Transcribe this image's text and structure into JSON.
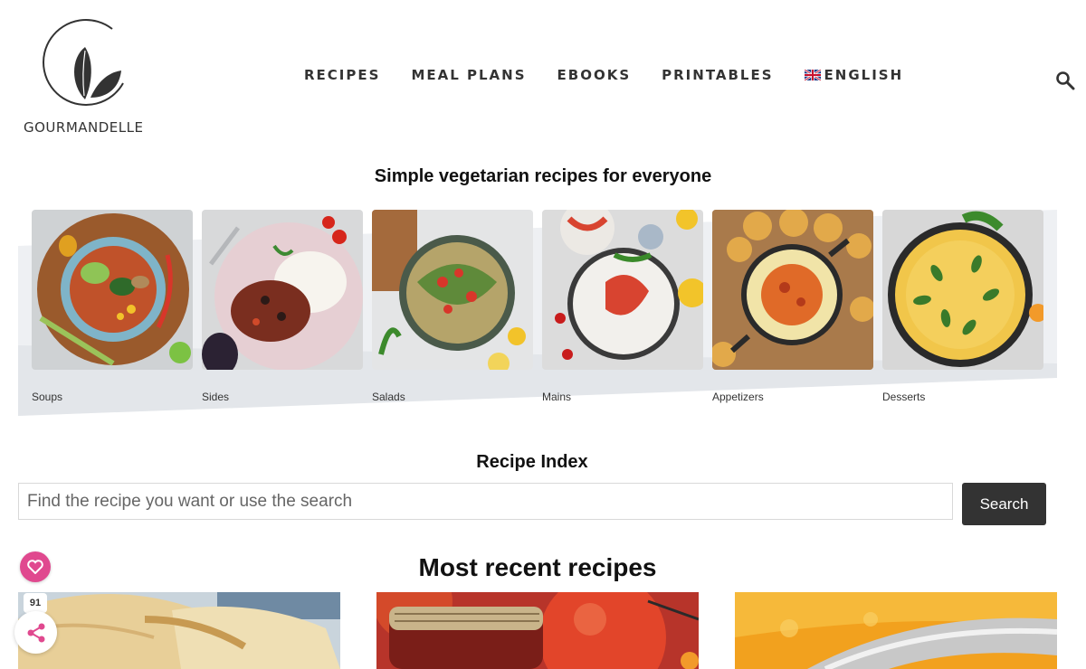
{
  "brand": {
    "name": "GOURMANDELLE"
  },
  "nav": {
    "items": [
      {
        "label": "RECIPES"
      },
      {
        "label": "MEAL PLANS"
      },
      {
        "label": "EBOOKS"
      },
      {
        "label": "PRINTABLES"
      },
      {
        "label": "ENGLISH",
        "icon": "uk-flag-icon"
      }
    ],
    "search_icon": "search-icon"
  },
  "tagline": "Simple vegetarian recipes for everyone",
  "categories": [
    {
      "label": "Soups"
    },
    {
      "label": "Sides"
    },
    {
      "label": "Salads"
    },
    {
      "label": "Mains"
    },
    {
      "label": "Appetizers"
    },
    {
      "label": "Desserts"
    }
  ],
  "recipe_index": {
    "title": "Recipe Index",
    "placeholder": "Find the recipe you want or use the search",
    "button_label": "Search"
  },
  "recent": {
    "title": "Most recent recipes"
  },
  "social": {
    "count": "91",
    "heart_icon": "heart-icon",
    "share_icon": "share-icon",
    "accent": "#e0498f"
  },
  "colors": {
    "button_bg": "#333333",
    "text": "#111111"
  }
}
